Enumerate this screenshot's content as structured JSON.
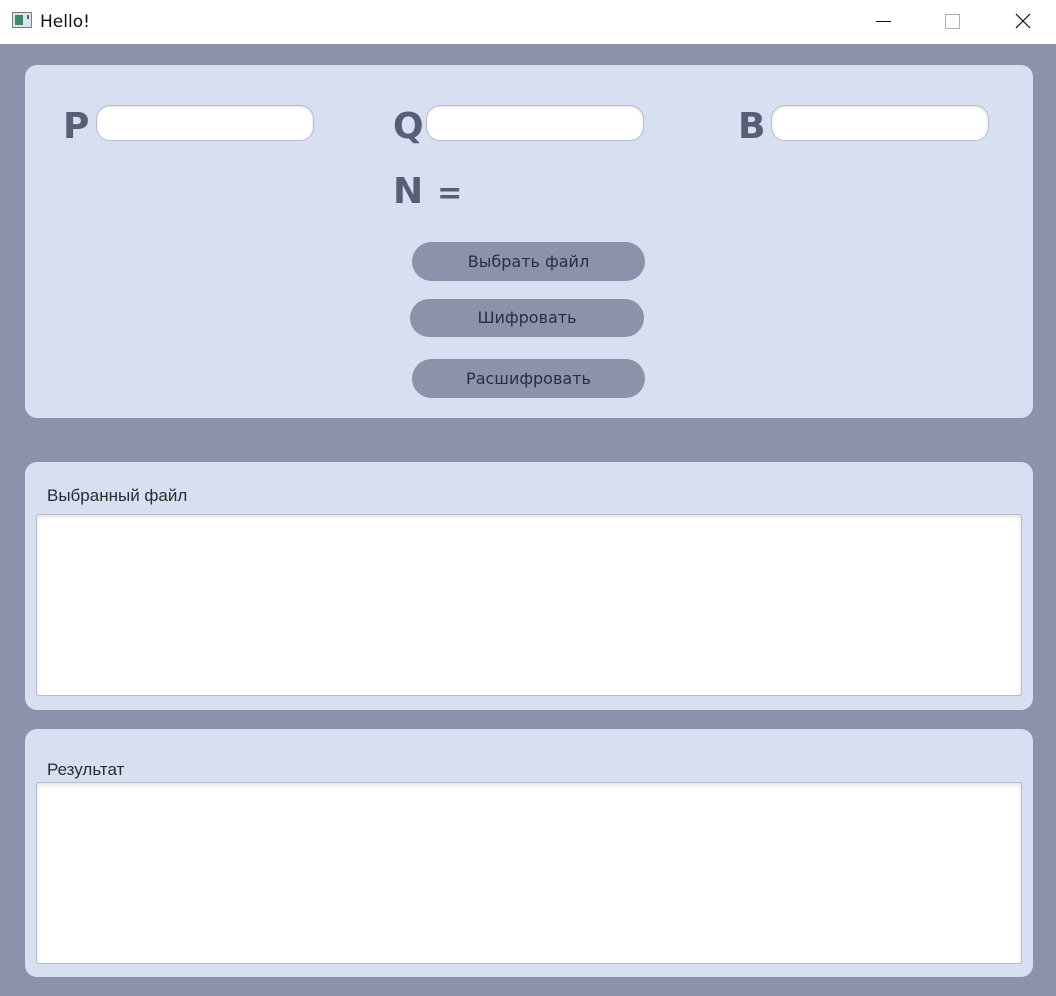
{
  "window": {
    "title": "Hello!",
    "controls": [
      "minimize",
      "maximize",
      "close"
    ]
  },
  "keys": {
    "p_label": "P",
    "q_label": "Q",
    "b_label": "B",
    "p_value": "",
    "q_value": "",
    "b_value": "",
    "n_label": "N",
    "n_equals": "=",
    "n_value": ""
  },
  "actions": {
    "choose_file": "Выбрать файл",
    "encrypt": "Шифровать",
    "decrypt": "Расшифровать"
  },
  "selected_file": {
    "label": "Выбранный файл",
    "content": ""
  },
  "result": {
    "label": "Результат",
    "content": ""
  },
  "colors": {
    "background": "#8c92aa",
    "panel": "#d7dff0",
    "button": "#8c92aa",
    "label": "#585e76"
  },
  "icons": {
    "app": "app-window-icon",
    "minimize": "minimize-icon",
    "maximize": "maximize-icon",
    "close": "close-icon"
  }
}
